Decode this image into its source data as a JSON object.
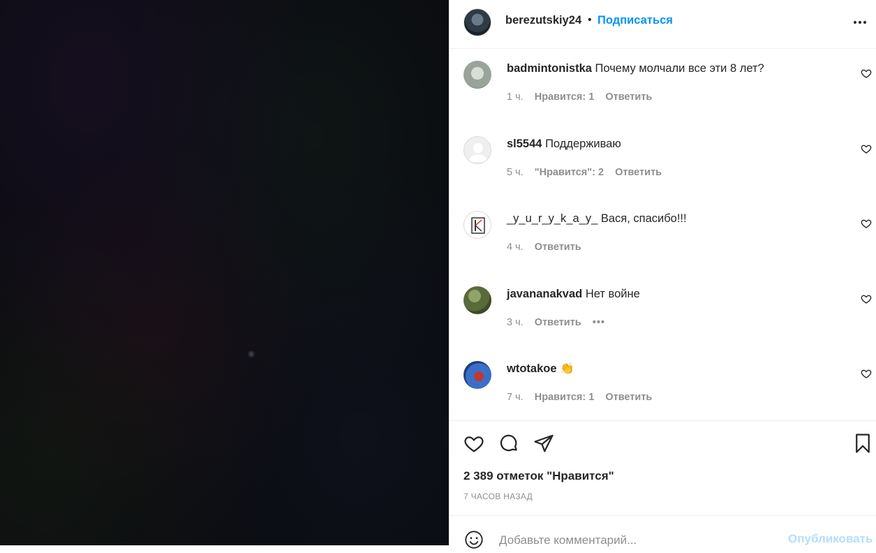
{
  "post": {
    "author": "berezutskiy24",
    "separator": "•",
    "follow_label": "Подписаться",
    "more_icon": "more-horizontal-icon"
  },
  "comments": [
    {
      "username": "badmintonistka",
      "text": "Почему молчали все эти 8 лет?",
      "time": "1 ч.",
      "likes": "Нравится: 1",
      "reply": "Ответить",
      "avatar_color": "#9aa39a"
    },
    {
      "username": "sl5544",
      "text": "Поддерживаю",
      "time": "5 ч.",
      "likes": "\"Нравится\": 2",
      "reply": "Ответить",
      "avatar_color": "#e6e6e6"
    },
    {
      "username": "_y_u_r_y_k_a_y_",
      "text": "Вася, спасибо!!!",
      "time": "4 ч.",
      "likes": "",
      "reply": "Ответить",
      "avatar_color": "#ffffff"
    },
    {
      "username": "javananakvad",
      "text": "Нет войне",
      "time": "3 ч.",
      "likes": "",
      "reply": "Ответить",
      "more": "•••",
      "avatar_color": "#5a6b3a"
    },
    {
      "username": "wtotakoe",
      "text": "👏",
      "time": "7 ч.",
      "likes": "Нравится: 1",
      "reply": "Ответить",
      "avatar_color": "#3a6fc9"
    }
  ],
  "actions": {
    "like_icon": "heart-icon",
    "comment_icon": "comment-icon",
    "share_icon": "send-icon",
    "save_icon": "bookmark-icon"
  },
  "likes_count": "2 389 отметок \"Нравится\"",
  "posted_ago": "7 ЧАСОВ НАЗАД",
  "add_comment": {
    "emoji_icon": "smiley-icon",
    "placeholder": "Добавьте комментарий...",
    "value": "",
    "publish_label": "Опубликовать"
  },
  "colors": {
    "accent": "#0095f6",
    "publish_disabled": "#b2dffc",
    "muted": "#8e8e8e",
    "text": "#262626"
  }
}
